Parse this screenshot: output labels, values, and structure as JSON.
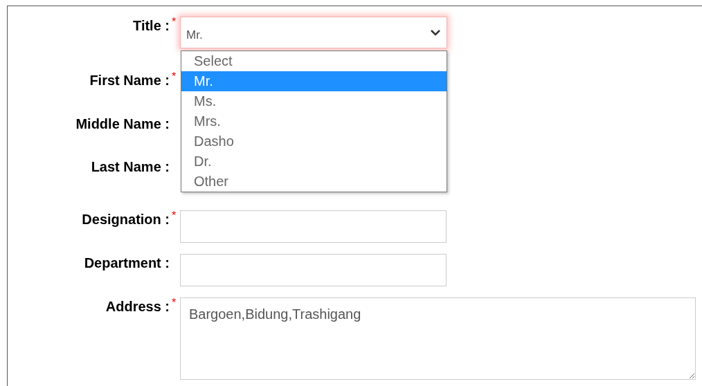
{
  "form": {
    "fields": [
      {
        "label": "Title :",
        "required_mark": "*",
        "kind": "select",
        "value": "Mr.",
        "focused": true
      },
      {
        "label": "First Name :",
        "required_mark": "*",
        "kind": "covered"
      },
      {
        "label": "Middle Name :",
        "kind": "covered"
      },
      {
        "label": "Last Name :",
        "kind": "covered"
      },
      {
        "label": "Designation :",
        "required_mark": "*",
        "kind": "text"
      },
      {
        "label": "Department :",
        "kind": "text"
      },
      {
        "label": "Address :",
        "required_mark": "*",
        "kind": "textarea",
        "value": "Bargoen,Bidung,Trashigang"
      }
    ]
  },
  "dropdown": {
    "options": [
      {
        "label": "Select",
        "selected": false
      },
      {
        "label": "Mr.",
        "selected": true
      },
      {
        "label": "Ms.",
        "selected": false
      },
      {
        "label": "Mrs.",
        "selected": false
      },
      {
        "label": "Dasho",
        "selected": false
      },
      {
        "label": "Dr.",
        "selected": false
      },
      {
        "label": "Other",
        "selected": false
      }
    ]
  }
}
